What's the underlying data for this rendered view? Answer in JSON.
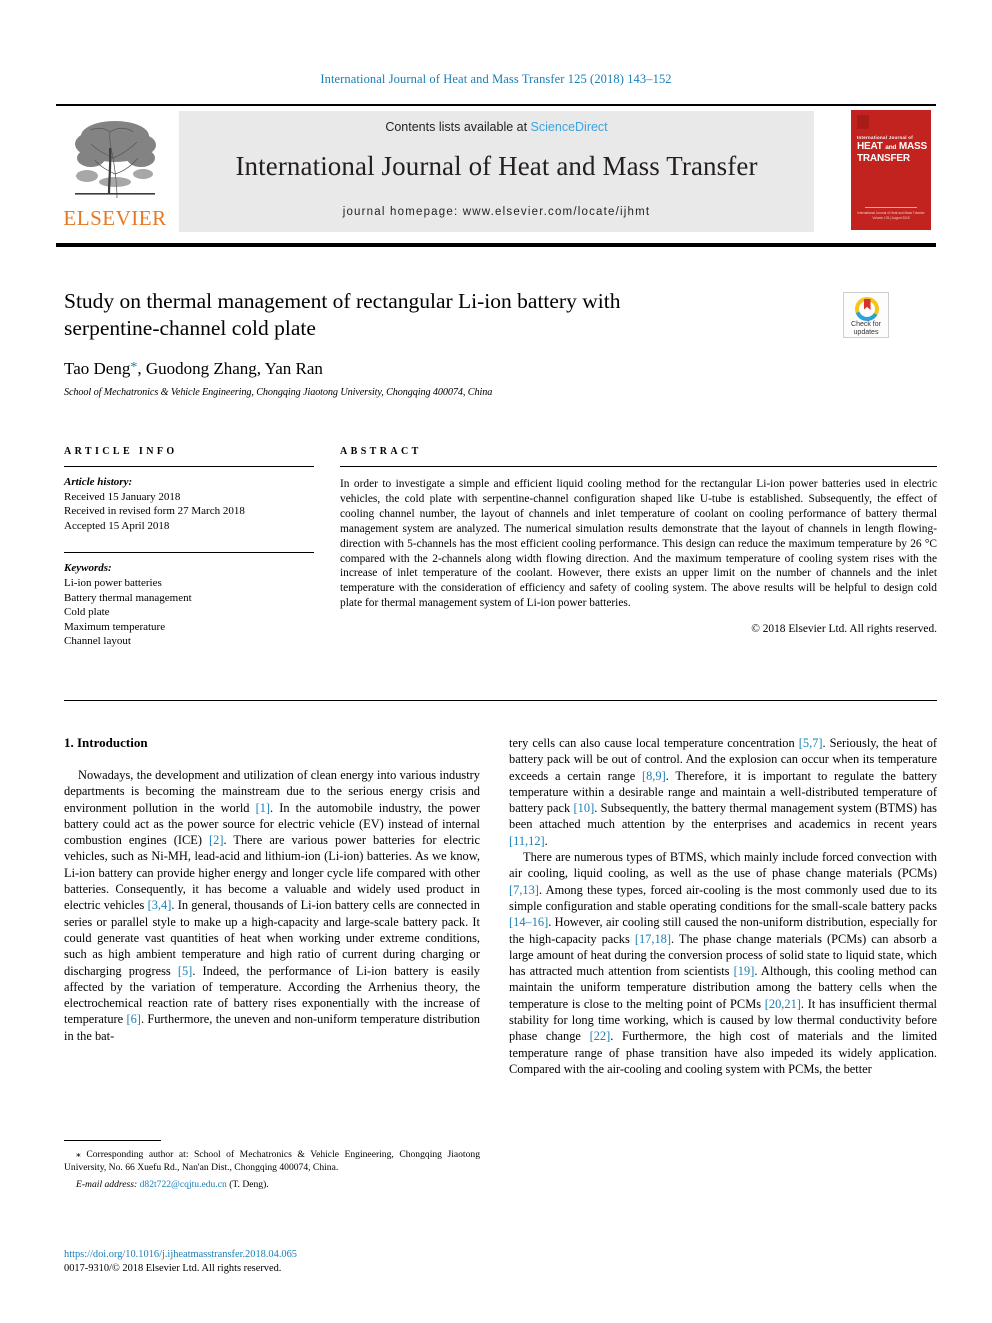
{
  "running_head": "International Journal of Heat and Mass Transfer 125 (2018) 143–152",
  "masthead": {
    "contents_prefix": "Contents lists available at ",
    "sciencedirect": "ScienceDirect",
    "journal_title": "International Journal of Heat and Mass Transfer",
    "homepage": "journal homepage: www.elsevier.com/locate/ijhmt",
    "publisher_logo_text": "ELSEVIER",
    "accent_link_color": "#3da3dd",
    "band_color": "#e9e9e9"
  },
  "cover": {
    "kicker": "International Journal of",
    "line1": "HEAT",
    "and": "and",
    "line2": "MASS",
    "line3": "TRANSFER",
    "footer": "International Journal of Heat and Mass Transfer",
    "footer2": "Volume 125 | August 2018",
    "color": "#c3231f"
  },
  "crossmark": {
    "line1": "Check for",
    "line2": "updates"
  },
  "article": {
    "title": "Study on thermal management of rectangular Li-ion battery with serpentine-channel cold plate",
    "authors": "Tao Deng",
    "authors_rest": ", Guodong Zhang, Yan Ran",
    "corresponding_marker": "*",
    "affiliation": "School of Mechatronics & Vehicle Engineering, Chongqing Jiaotong University, Chongqing 400074, China"
  },
  "article_info": {
    "label": "ARTICLE INFO",
    "history_label": "Article history:",
    "history": [
      "Received 15 January 2018",
      "Received in revised form 27 March 2018",
      "Accepted 15 April 2018"
    ],
    "keywords_label": "Keywords:",
    "keywords": [
      "Li-ion power batteries",
      "Battery thermal management",
      "Cold plate",
      "Maximum temperature",
      "Channel layout"
    ]
  },
  "abstract": {
    "label": "ABSTRACT",
    "text": "In order to investigate a simple and efficient liquid cooling method for the rectangular Li-ion power batteries used in electric vehicles, the cold plate with serpentine-channel configuration shaped like U-tube is established. Subsequently, the effect of cooling channel number, the layout of channels and inlet temperature of coolant on cooling performance of battery thermal management system are analyzed. The numerical simulation results demonstrate that the layout of channels in length flowing-direction with 5-channels has the most efficient cooling performance. This design can reduce the maximum temperature by 26 °C compared with the 2-channels along width flowing direction. And the maximum temperature of cooling system rises with the increase of inlet temperature of the coolant. However, there exists an upper limit on the number of channels and the inlet temperature with the consideration of efficiency and safety of cooling system. The above results will be helpful to design cold plate for thermal management system of Li-ion power batteries.",
    "rights": "© 2018 Elsevier Ltd. All rights reserved."
  },
  "body": {
    "section_heading": "1. Introduction",
    "left_para_1": "Nowadays, the development and utilization of clean energy into various industry departments is becoming the mainstream due to the serious energy crisis and environment pollution in the world [1]. In the automobile industry, the power battery could act as the power source for electric vehicle (EV) instead of internal combustion engines (ICE) [2]. There are various power batteries for electric vehicles, such as Ni-MH, lead-acid and lithium-ion (Li-ion) batteries. As we know, Li-ion battery can provide higher energy and longer cycle life compared with other batteries. Consequently, it has become a valuable and widely used product in electric vehicles [3,4]. In general, thousands of Li-ion battery cells are connected in series or parallel style to make up a high-capacity and large-scale battery pack. It could generate vast quantities of heat when working under extreme conditions, such as high ambient temperature and high ratio of current during charging or discharging progress [5]. Indeed, the performance of Li-ion battery is easily affected by the variation of temperature. According the Arrhenius theory, the electrochemical reaction rate of battery rises exponentially with the increase of temperature [6]. Furthermore, the uneven and non-uniform temperature distribution in the bat-",
    "right_para_1": "tery cells can also cause local temperature concentration [5,7]. Seriously, the heat of battery pack will be out of control. And the explosion can occur when its temperature exceeds a certain range [8,9]. Therefore, it is important to regulate the battery temperature within a desirable range and maintain a well-distributed temperature of battery pack [10]. Subsequently, the battery thermal management system (BTMS) has been attached much attention by the enterprises and academics in recent years [11,12].",
    "right_para_2": "There are numerous types of BTMS, which mainly include forced convection with air cooling, liquid cooling, as well as the use of phase change materials (PCMs) [7,13]. Among these types, forced air-cooling is the most commonly used due to its simple configuration and stable operating conditions for the small-scale battery packs [14–16]. However, air cooling still caused the non-uniform distribution, especially for the high-capacity packs [17,18]. The phase change materials (PCMs) can absorb a large amount of heat during the conversion process of solid state to liquid state, which has attracted much attention from scientists [19]. Although, this cooling method can maintain the uniform temperature distribution among the battery cells when the temperature is close to the melting point of PCMs [20,21]. It has insufficient thermal stability for long time working, which is caused by low thermal conductivity before phase change [22]. Furthermore, the high cost of materials and the limited temperature range of phase transition have also impeded its widely application. Compared with the air-cooling and cooling system with PCMs, the better"
  },
  "footnote": {
    "marker": "⁎",
    "text": "Corresponding author at: School of Mechatronics & Vehicle Engineering, Chongqing Jiaotong University, No. 66 Xuefu Rd., Nan'an Dist., Chongqing 400074, China.",
    "email_label": "E-mail address:",
    "email": "d82t722@cqjtu.edu.cn",
    "email_owner": "(T. Deng)."
  },
  "footer": {
    "doi": "https://doi.org/10.1016/j.ijheatmasstransfer.2018.04.065",
    "issn": "0017-9310/© 2018 Elsevier Ltd. All rights reserved."
  }
}
